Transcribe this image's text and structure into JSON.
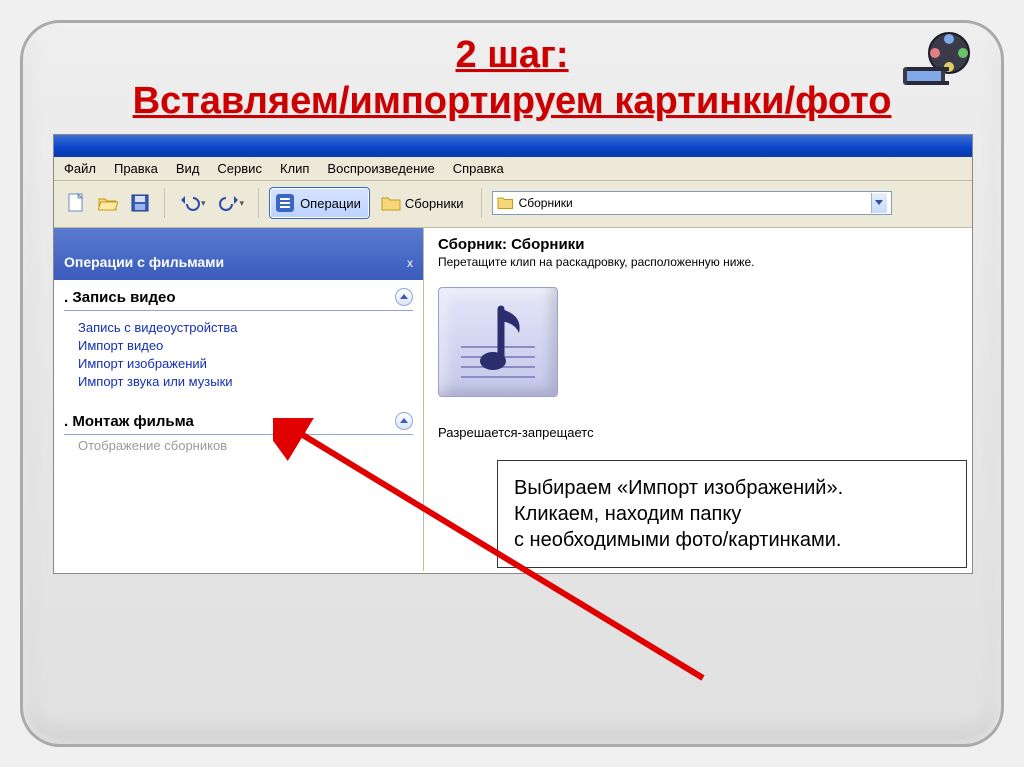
{
  "title_lines": [
    "2 шаг:",
    "Вставляем/импортируем картинки/фото"
  ],
  "menu": {
    "file": "Файл",
    "edit": "Правка",
    "view": "Вид",
    "tools": "Сервис",
    "clip": "Клип",
    "play": "Воспроизведение",
    "help": "Справка"
  },
  "toolbar": {
    "tasks_label": "Операции",
    "collections_label": "Сборники",
    "combo_value": "Сборники"
  },
  "side": {
    "header": "Операции с фильмами",
    "close": "x",
    "section1_num": ".",
    "section1": " Запись видео",
    "links1": {
      "capture": "Запись с видеоустройства",
      "import_video": "Импорт видео",
      "import_images": "Импорт изображений",
      "import_audio": "Импорт звука или музыки"
    },
    "section2": ". Монтаж фильма",
    "disabled": "Отображение сборников"
  },
  "content": {
    "title": "Сборник: Сборники",
    "sub": "Перетащите клип на раскадровку, расположенную ниже.",
    "caption": "Разрешается-запрещаетс"
  },
  "callout": {
    "l1": "Выбираем «Импорт изображений».",
    "l2": "Кликаем, находим папку",
    "l3": "с необходимыми фото/картинками."
  }
}
